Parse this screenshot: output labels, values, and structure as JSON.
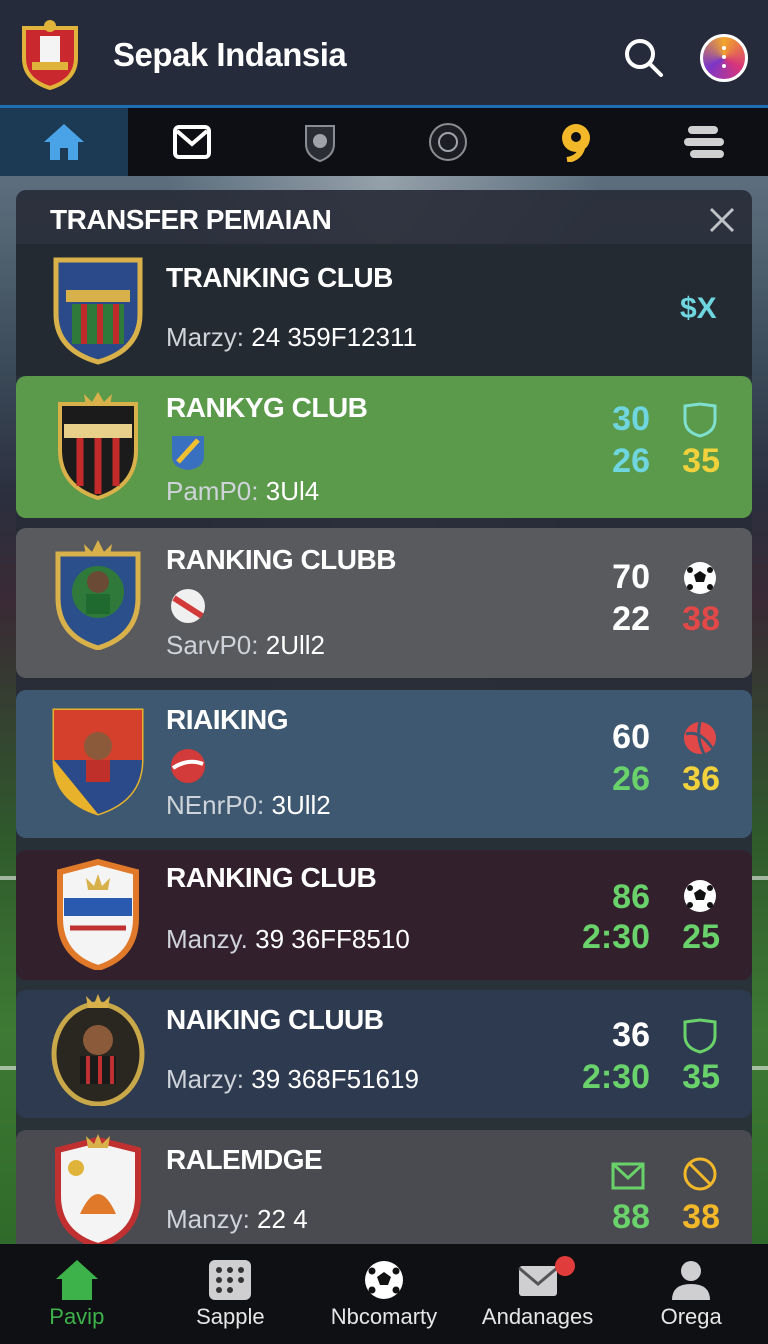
{
  "app": {
    "title": "Sepak Indansia"
  },
  "tabs": [
    {
      "icon": "home-icon",
      "active": true
    },
    {
      "icon": "mail-icon"
    },
    {
      "icon": "club-shield-icon"
    },
    {
      "icon": "club-emblem-icon"
    },
    {
      "icon": "coin-icon"
    },
    {
      "icon": "menu-icon"
    }
  ],
  "panel": {
    "title": "TRANSFER PEMAIAN"
  },
  "cards": [
    {
      "name": "TRANKING CLUB",
      "sub_label": "Marzy:",
      "sub_value": "24 359F12311",
      "tag": "$X",
      "bg": "#232a31"
    },
    {
      "name": "RANKYG CLUB",
      "sub_label": "PamP0:",
      "sub_value": "3Ul4",
      "stat_top": "30",
      "stat_bottom": "26",
      "stat_right": "35",
      "icon": "shield-icon",
      "bg": "#5a9a4a"
    },
    {
      "name": "RANKING CLUBB",
      "sub_label": "SarvP0:",
      "sub_value": "2Ull2",
      "stat_top": "70",
      "stat_bottom": "22",
      "stat_right": "38",
      "icon": "soccer-ball-icon",
      "bg": "#585a5d"
    },
    {
      "name": "RIAIKING",
      "sub_label": "NEnrP0:",
      "sub_value": "3Ull2",
      "stat_top": "60",
      "stat_bottom": "26",
      "stat_right": "36",
      "icon": "volleyball-icon",
      "bg": "#3d5870"
    },
    {
      "name": "RANKING CLUB",
      "sub_label": "Manzy.",
      "sub_value": "39 36FF8510",
      "stat_top": "86",
      "stat_bottom": "2:30",
      "stat_right": "25",
      "icon": "soccer-ball-icon",
      "bg": "#33202d"
    },
    {
      "name": "NAIKING CLUUB",
      "sub_label": "Marzy:",
      "sub_value": "39 368F51619",
      "stat_top": "36",
      "stat_bottom": "2:30",
      "stat_right": "35",
      "icon": "shield-icon",
      "bg": "#2e3a50"
    },
    {
      "name": "RALEMDGE",
      "sub_label": "Manzy:",
      "sub_value": "22 4",
      "stat_bottom": "88",
      "stat_right": "38",
      "icon": "no-entry-icon",
      "bg": "#4a4b50"
    }
  ],
  "bottom_nav": [
    {
      "label": "Pavip",
      "icon": "home-icon",
      "active": true
    },
    {
      "label": "Sapple",
      "icon": "grid-icon"
    },
    {
      "label": "Nbcomarty",
      "icon": "soccer-ball-icon"
    },
    {
      "label": "Andanages",
      "icon": "mail-icon",
      "badge": "?"
    },
    {
      "label": "Orega",
      "icon": "user-icon"
    }
  ],
  "colors": {
    "accent_green": "#3db24a",
    "cyan": "#6fd6e0",
    "yellow": "#f2d23c",
    "red": "#e24848",
    "green": "#6ad26a"
  }
}
